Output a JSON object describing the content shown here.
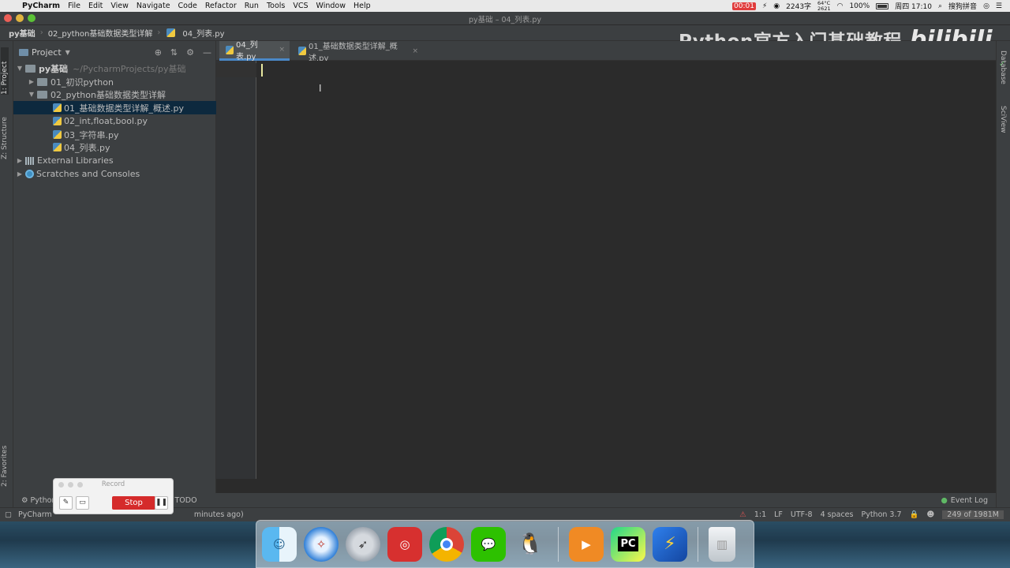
{
  "menubar": {
    "app": "PyCharm",
    "items": [
      "File",
      "Edit",
      "View",
      "Navigate",
      "Code",
      "Refactor",
      "Run",
      "Tools",
      "VCS",
      "Window",
      "Help"
    ],
    "rec_time": "00:01",
    "word_count": "2243字",
    "temp_top": "64°C",
    "temp_bottom": "2621",
    "battery": "100%",
    "clock": "周四 17:10",
    "input_method": "搜狗拼音"
  },
  "window": {
    "title": "py基础 – 04_列表.py"
  },
  "breadcrumb": [
    "py基础",
    "02_python基础数据类型详解",
    "04_列表.py"
  ],
  "watermark": {
    "text": "Python官方入门基础教程",
    "logo": "bilibili"
  },
  "left_strip": {
    "project_tab": "1: Project",
    "structure_tab": "Z: Structure",
    "favorites_tab": "2: Favorites"
  },
  "right_strip": {
    "database_tab": "Database",
    "sciview_tab": "SciView"
  },
  "project_panel": {
    "title": "Project",
    "tree": [
      {
        "label": "py基础",
        "hint": "~/PycharmProjects/py基础"
      },
      {
        "label": "01_初识python"
      },
      {
        "label": "02_python基础数据类型详解"
      },
      {
        "label": "01_基础数据类型详解_概述.py"
      },
      {
        "label": "02_int,float,bool.py"
      },
      {
        "label": "03_字符串.py"
      },
      {
        "label": "04_列表.py"
      },
      {
        "label": "External Libraries"
      },
      {
        "label": "Scratches and Consoles"
      }
    ]
  },
  "tabs": [
    {
      "label": "04_列表.py"
    },
    {
      "label": "01_基础数据类型详解_概述.py"
    }
  ],
  "bottom_bar": {
    "python_console": "Python",
    "todo": "TODO",
    "event_log": "Event Log"
  },
  "status": {
    "message_start": "PyCharm",
    "message_end": "minutes ago)",
    "position": "1:1",
    "line_sep": "LF",
    "encoding": "UTF-8",
    "indent": "4 spaces",
    "interpreter": "Python 3.7",
    "memory": "249 of 1981M"
  },
  "record": {
    "title": "Record",
    "stop_label": "Stop"
  },
  "dock": [
    "Finder",
    "Safari",
    "Launchpad",
    "NetEase Music",
    "Chrome",
    "WeChat",
    "QQ",
    "Video",
    "PyCharm",
    "Thunder",
    "Trash"
  ],
  "dock_labels": {
    "pycharm": "PC"
  }
}
